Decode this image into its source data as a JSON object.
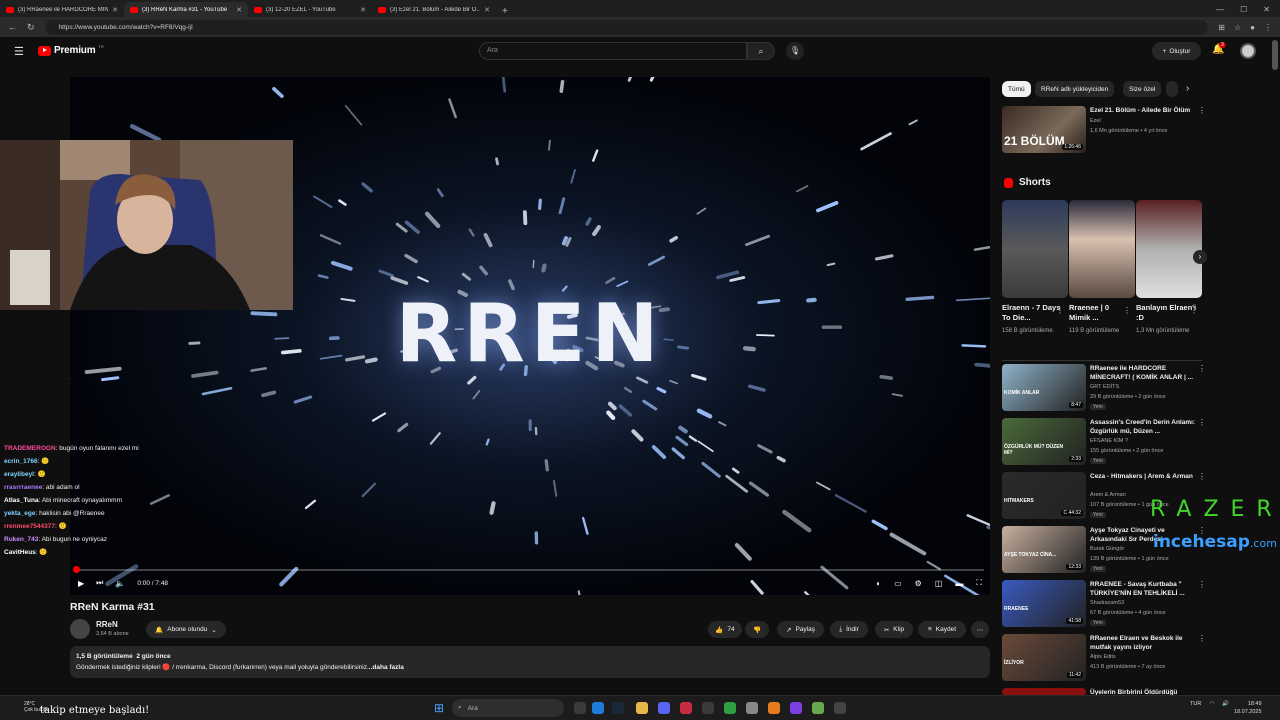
{
  "browser": {
    "tabs": [
      {
        "label": "(3) RRaenee ile HARDCORE MİNE..."
      },
      {
        "label": "(3) RReN Karma #31 - YouTube"
      },
      {
        "label": "(3) 12-20 EZEL - YouTube"
      },
      {
        "label": "(3) Ezel 21. Bölüm - Ailede Bir Ö..."
      }
    ],
    "url": "https://www.youtube.com/watch?v=RF8/Vqg-ijI"
  },
  "header": {
    "logo_text": "Premium",
    "logo_sup": "TR",
    "search_placeholder": "Ara",
    "create_label": "Oluştur",
    "notif_count": "3"
  },
  "player": {
    "overlay_text": "RREN",
    "time": "0:00 / 7:48",
    "progress": 0.0
  },
  "chat": [
    {
      "user": "TRADEMEROGN",
      "msg": ": bugün oyun falanmı ezel mi",
      "color": "#ff4b9a"
    },
    {
      "user": "ecrin_1766",
      "msg": ": 🙂",
      "color": "#7fd3ff"
    },
    {
      "user": "eraylibeyl",
      "msg": ": 🙂",
      "color": "#7fd3ff"
    },
    {
      "user": "rrasrrraenee",
      "msg": ": abi adam ol",
      "color": "#b07bff"
    },
    {
      "user": "Atlas_Tuna",
      "msg": ": Abi minecraft oynayalımmm",
      "color": "#ffffff"
    },
    {
      "user": "yekta_ege",
      "msg": ": haklisin abi @Rraenee",
      "color": "#7fd3ff"
    },
    {
      "user": "rrenmee7544377",
      "msg": ": 🙂",
      "color": "#ff4b6b"
    },
    {
      "user": "Ruken_743",
      "msg": ": Abi bugun ne oyniycaz",
      "color": "#c98bff"
    },
    {
      "user": "CavitHeus",
      "msg": ": 🙂",
      "color": "#ffffff"
    }
  ],
  "video": {
    "title": "RReN Karma #31",
    "channel": "RReN",
    "subscribers": "3,64 B abone",
    "subscribe_label": "Abone olundu",
    "likes": "74",
    "share_label": "Paylaş",
    "download_label": "İndir",
    "clip_label": "Klip",
    "save_label": "Kaydet",
    "views": "1,5 B görüntüleme",
    "age": "2 gün önce",
    "description_pre": "Göndermek istediğiniz klipleri 🔴 / rrenkarma",
    "description_post": ", Discord (furkanrren) veya mail yoluyla gönderebilirsiniz.",
    "more_label": "..daha fazla"
  },
  "sidebar": {
    "chips": [
      "Tümü",
      "RReN adlı yükleyiciden",
      "Size özel"
    ],
    "top_rec": {
      "title": "Ezel 21. Bölüm - Ailede Bir Ölüm",
      "channel": "Ezel",
      "meta": "1,6 Mn görüntüleme • 4 yıl önce",
      "duration": "1:26:46",
      "thumb_text": "21 BÖLÜM"
    },
    "shorts_heading": "Shorts",
    "shorts": [
      {
        "title": "Elraenn - 7 Days To Die...",
        "views": "158 B görüntüleme"
      },
      {
        "title": "Rraenee | 0 Mimik ...",
        "views": "119 B görüntüleme"
      },
      {
        "title": "Banlayın Elraen'i :D",
        "views": "1,3 Mn görüntüleme"
      }
    ],
    "recs": [
      {
        "title": "RRaenee ile HARDCORE MİNECRAFT! ( KOMİK ANLAR | ...",
        "channel": "GRT EDİTS",
        "meta": "29 B görüntüleme • 2 gün önce",
        "badge": "Yeni",
        "duration": "8:47",
        "thumb_text": "KOMİK ANLAR"
      },
      {
        "title": "Assassin's Creed'in Derin Anlamı: Özgürlük mü, Düzen ...",
        "channel": "EFSANE KİM ?",
        "meta": "155 görüntüleme • 2 gün önce",
        "badge": "Yeni",
        "duration": "2:33",
        "thumb_text": "ÖZGÜRLÜK MÜ? DÜZEN Mİ?"
      },
      {
        "title": "Ceza - Hitmakers | Arem & Arman",
        "channel": "Arem & Arman",
        "meta": "107 B görüntüleme • 1 gün önce",
        "badge": "Yeni",
        "duration": "C 44:32",
        "thumb_text": "HITMAKERS"
      },
      {
        "title": "Ayşe Tokyaz Cinayeti ve Arkasındaki Sır Perdesi",
        "channel": "Burak Güngör",
        "meta": "139 B görüntüleme • 1 gün önce",
        "badge": "Yeni",
        "duration": "12:33",
        "thumb_text": "AYŞE TOKYAZ CİNA..."
      },
      {
        "title": "RRAENEE - Savaş Kurtbaba \" TÜRKİYE'NİN EN TEHLİKELİ ...",
        "channel": "Shadrazam53",
        "meta": "67 B görüntüleme • 4 gün önce",
        "badge": "Yeni",
        "duration": "41:58",
        "thumb_text": "RRAENEE"
      },
      {
        "title": "RRaenee Elraen ve Beskok ile mutfak yayını izliyor",
        "channel": "Alpis Edits",
        "meta": "413 B görüntüleme • 7 ay önce",
        "badge": "",
        "duration": "11:42",
        "thumb_text": "İZLİYOR"
      },
      {
        "title": "Üyelerin Birbirini Öldürdüğü",
        "channel": "",
        "meta": "",
        "badge": "",
        "duration": "",
        "thumb_text": ""
      }
    ]
  },
  "overlay": {
    "razer": "RAZER",
    "incehesap": "incehesap",
    "incehesap_tld": ".com",
    "follow_text": "takip etmeye başladı!"
  },
  "taskbar": {
    "weather_temp": "28°C",
    "weather_desc": "Çok bulutlu",
    "search_placeholder": "Ara",
    "lang": "TUR",
    "time": "18:49",
    "date": "18.07.2025"
  }
}
